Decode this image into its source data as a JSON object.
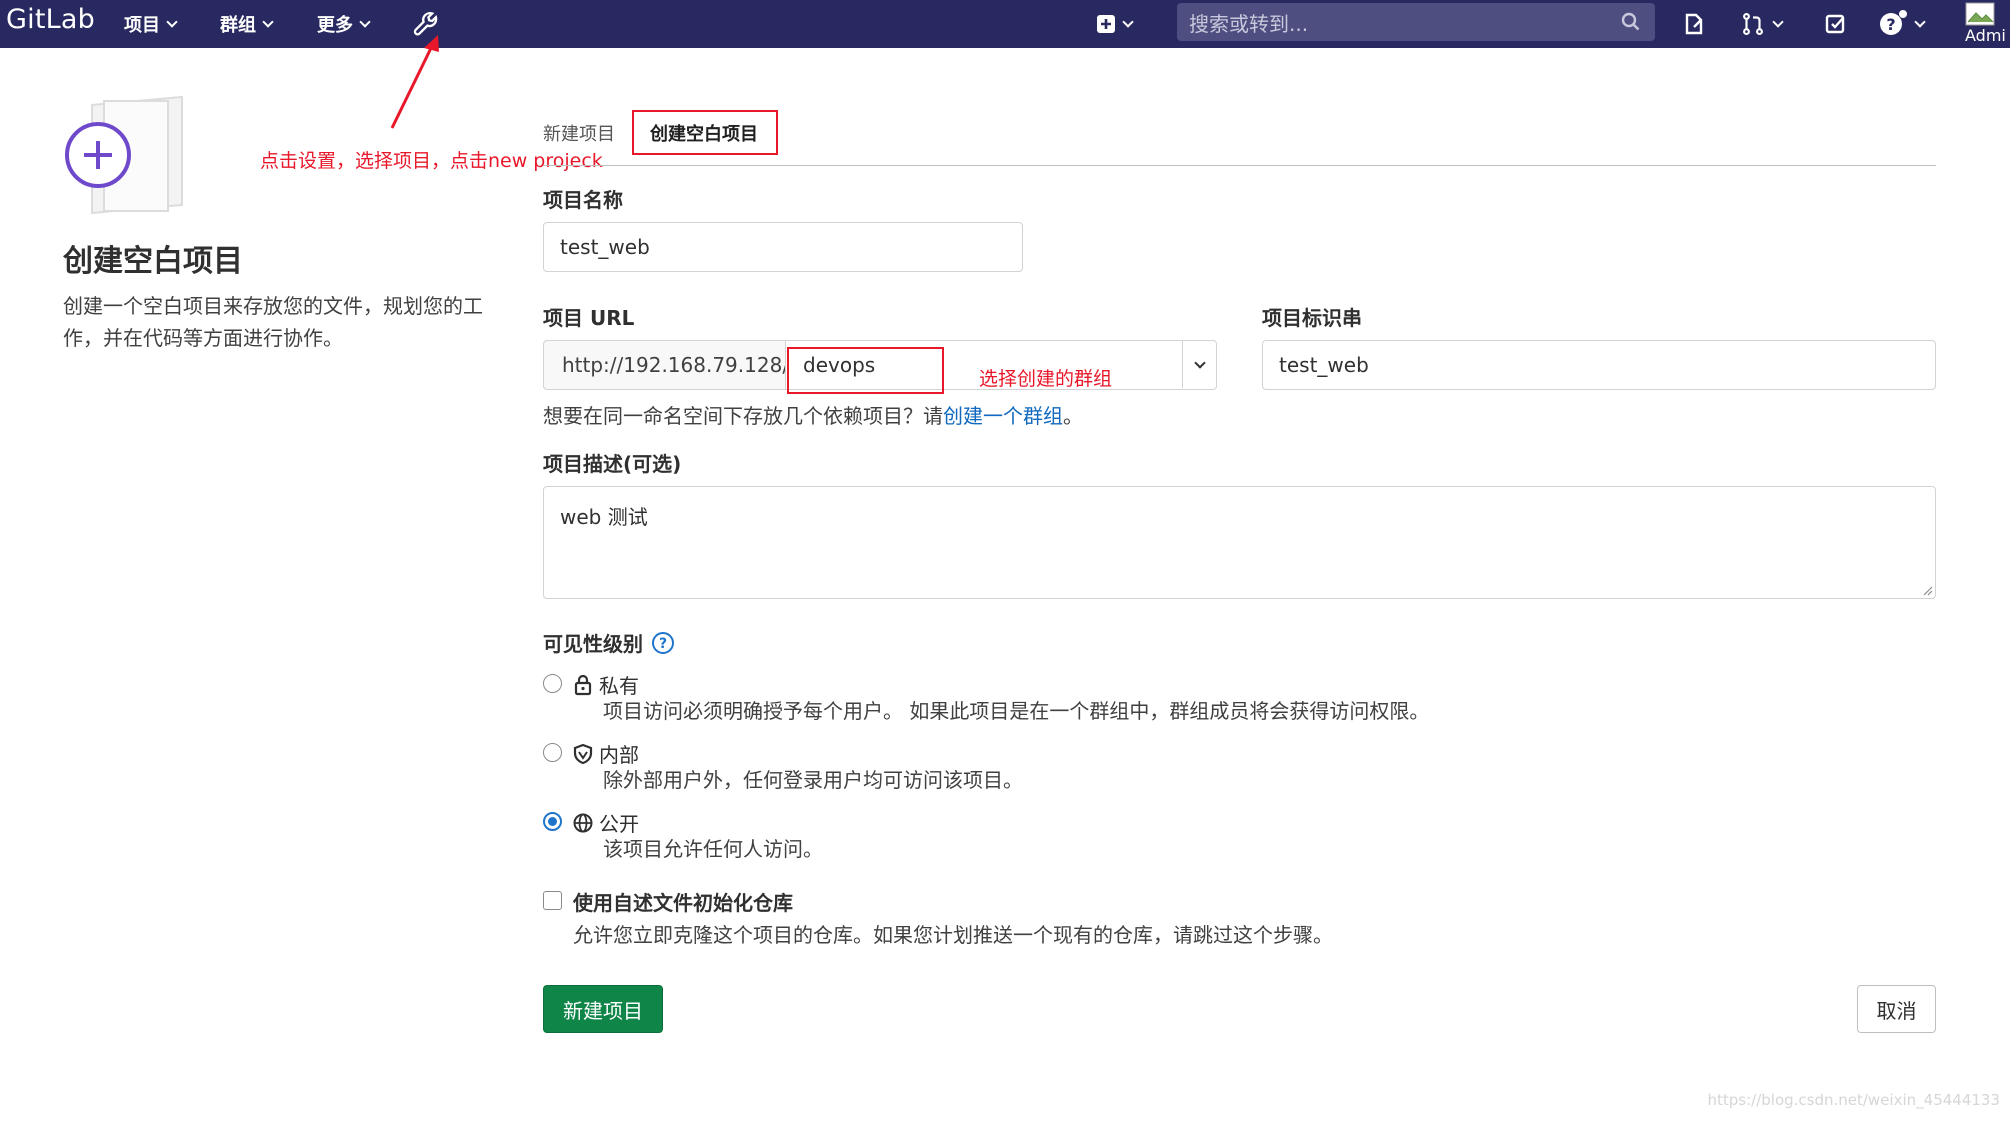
{
  "navbar": {
    "brand": "GitLab",
    "menu_projects": "项目",
    "menu_groups": "群组",
    "menu_more": "更多",
    "search_placeholder": "搜索或转到...",
    "avatar_text": "Admi"
  },
  "left": {
    "title": "创建空白项目",
    "description": "创建一个空白项目来存放您的文件，规划您的工作，并在代码等方面进行协作。"
  },
  "annotations": {
    "settings_hint": "点击设置，选择项目，点击new projeck",
    "group_hint": "选择创建的群组"
  },
  "tabs": {
    "new_project": "新建项目",
    "blank_project": "创建空白项目"
  },
  "form": {
    "name_label": "项目名称",
    "name_value": "test_web",
    "url_label": "项目 URL",
    "url_prefix": "http://192.168.79.128/",
    "namespace_value": "devops",
    "slug_label": "项目标识串",
    "slug_value": "test_web",
    "group_help_prefix": "想要在同一命名空间下存放几个依赖项目？请",
    "group_help_link": "创建一个群组",
    "group_help_suffix": "。",
    "desc_label": "项目描述(可选)",
    "desc_value": "web 测试",
    "visibility_label": "可见性级别",
    "visibility": [
      {
        "label": "私有",
        "desc": "项目访问必须明确授予每个用户。 如果此项目是在一个群组中，群组成员将会获得访问权限。",
        "icon": "lock-icon",
        "selected": false
      },
      {
        "label": "内部",
        "desc": "除外部用户外，任何登录用户均可访问该项目。",
        "icon": "shield-icon",
        "selected": false
      },
      {
        "label": "公开",
        "desc": "该项目允许任何人访问。",
        "icon": "globe-icon",
        "selected": true
      }
    ],
    "readme_label": "使用自述文件初始化仓库",
    "readme_desc": "允许您立即克隆这个项目的仓库。如果您计划推送一个现有的仓库，请跳过这个步骤。",
    "readme_checked": false,
    "create_button": "新建项目",
    "cancel_button": "取消"
  },
  "colors": {
    "navbar_bg": "#292961",
    "primary_button": "#108548",
    "annotation_red": "#e8182a",
    "link_blue": "#1068bf"
  },
  "watermark": "https://blog.csdn.net/weixin_45444133"
}
